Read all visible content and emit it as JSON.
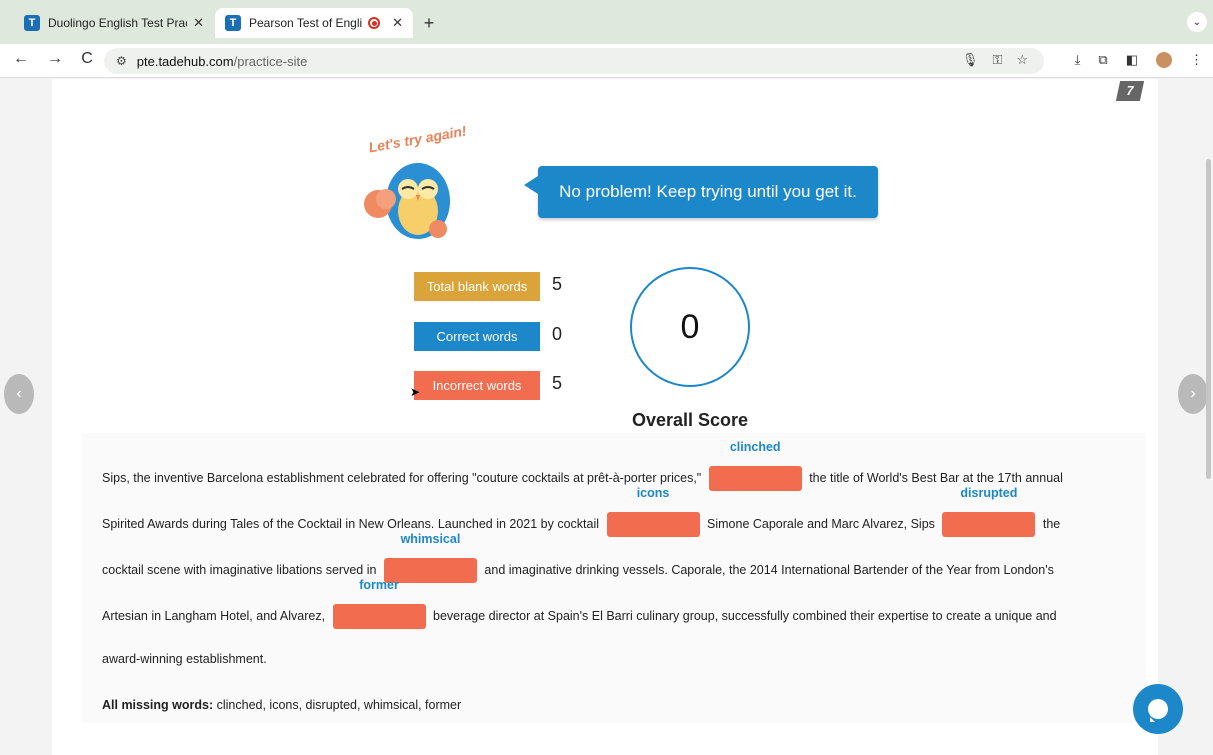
{
  "browser": {
    "tabs": [
      {
        "favicon": "T",
        "title": "Duolingo English Test Practic",
        "close": "✕"
      },
      {
        "favicon": "T",
        "title": "Pearson Test of English P",
        "close": "✕"
      }
    ],
    "new_tab": "+",
    "tab_menu": "⌄",
    "nav": {
      "back": "←",
      "forward": "→",
      "reload": "C"
    },
    "url_host": "pte.tadehub.com",
    "url_path": "/practice-site"
  },
  "page": {
    "corner_badge": "7",
    "owl_caption": "Let's try again!",
    "bubble_text": "No problem! Keep trying until you get it.",
    "stats": {
      "total_blank_label": "Total blank words",
      "total_blank_value": "5",
      "correct_label": "Correct words",
      "correct_value": "0",
      "incorrect_label": "Incorrect words",
      "incorrect_value": "5"
    },
    "score": {
      "value": "0",
      "label": "Overall Score"
    },
    "passage": {
      "line1_a": "Sips, the inventive Barcelona establishment celebrated for offering \"couture cocktails at prêt-à-porter prices,\"",
      "blank1": "clinched",
      "line1_b": "the title of World's Best Bar at the 17th annual",
      "line2_a": "Spirited Awards during Tales of the Cocktail in New Orleans. Launched in 2021 by cocktail",
      "blank2": "icons",
      "line2_b": "Simone Caporale and Marc Alvarez, Sips",
      "blank3": "disrupted",
      "line2_c": "the",
      "line3_a": "cocktail scene with imaginative libations served in",
      "blank4": "whimsical",
      "line3_b": "and imaginative drinking vessels. Caporale, the 2014 International Bartender of the Year from London's",
      "line4_a": "Artesian in Langham Hotel, and Alvarez,",
      "blank5": "former",
      "line4_b": "beverage director at Spain's El Barri culinary group, successfully combined their expertise to create a unique and",
      "line5": "award-winning establishment."
    },
    "missing_label": "All missing words:",
    "missing_words": "clinched, icons, disrupted, whimsical, former"
  }
}
